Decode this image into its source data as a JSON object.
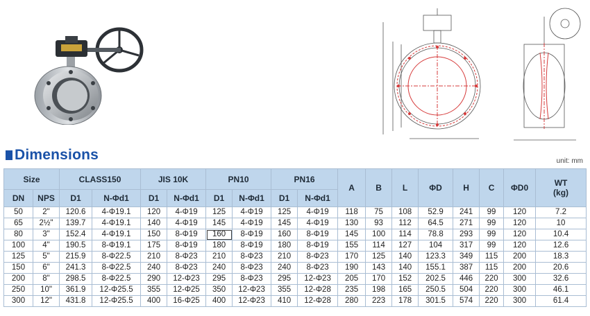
{
  "heading": "Dimensions",
  "unit_label": "unit: mm",
  "header_groups": [
    "Size",
    "CLASS150",
    "JIS 10K",
    "PN10",
    "PN16"
  ],
  "header_single": [
    "A",
    "B",
    "L",
    "ΦD",
    "H",
    "C",
    "ΦD0",
    "WT\n(kg)"
  ],
  "sub_headers": [
    "DN",
    "NPS",
    "D1",
    "N-Φd1",
    "D1",
    "N-Φd1",
    "D1",
    "N-Φd1",
    "D1",
    "N-Φd1"
  ],
  "rows": [
    [
      "50",
      "2\"",
      "120.6",
      "4-Φ19.1",
      "120",
      "4-Φ19",
      "125",
      "4-Φ19",
      "125",
      "4-Φ19",
      "118",
      "75",
      "108",
      "52.9",
      "241",
      "99",
      "120",
      "7.2"
    ],
    [
      "65",
      "2½\"",
      "139.7",
      "4-Φ19.1",
      "140",
      "4-Φ19",
      "145",
      "4-Φ19",
      "145",
      "4-Φ19",
      "130",
      "93",
      "112",
      "64.5",
      "271",
      "99",
      "120",
      "10"
    ],
    [
      "80",
      "3\"",
      "152.4",
      "4-Φ19.1",
      "150",
      "8-Φ19",
      "160",
      "8-Φ19",
      "160",
      "8-Φ19",
      "145",
      "100",
      "114",
      "78.8",
      "293",
      "99",
      "120",
      "10.4"
    ],
    [
      "100",
      "4\"",
      "190.5",
      "8-Φ19.1",
      "175",
      "8-Φ19",
      "180",
      "8-Φ19",
      "180",
      "8-Φ19",
      "155",
      "114",
      "127",
      "104",
      "317",
      "99",
      "120",
      "12.6"
    ],
    [
      "125",
      "5\"",
      "215.9",
      "8-Φ22.5",
      "210",
      "8-Φ23",
      "210",
      "8-Φ23",
      "210",
      "8-Φ23",
      "170",
      "125",
      "140",
      "123.3",
      "349",
      "115",
      "200",
      "18.3"
    ],
    [
      "150",
      "6\"",
      "241.3",
      "8-Φ22.5",
      "240",
      "8-Φ23",
      "240",
      "8-Φ23",
      "240",
      "8-Φ23",
      "190",
      "143",
      "140",
      "155.1",
      "387",
      "115",
      "200",
      "20.6"
    ],
    [
      "200",
      "8\"",
      "298.5",
      "8-Φ22.5",
      "290",
      "12-Φ23",
      "295",
      "8-Φ23",
      "295",
      "12-Φ23",
      "205",
      "170",
      "152",
      "202.5",
      "446",
      "220",
      "300",
      "32.6"
    ],
    [
      "250",
      "10\"",
      "361.9",
      "12-Φ25.5",
      "355",
      "12-Φ25",
      "350",
      "12-Φ23",
      "355",
      "12-Φ28",
      "235",
      "198",
      "165",
      "250.5",
      "504",
      "220",
      "300",
      "46.1"
    ],
    [
      "300",
      "12\"",
      "431.8",
      "12-Φ25.5",
      "400",
      "16-Φ25",
      "400",
      "12-Φ23",
      "410",
      "12-Φ28",
      "280",
      "223",
      "178",
      "301.5",
      "574",
      "220",
      "300",
      "61.4"
    ]
  ],
  "colors": {
    "accent": "#1a52a8",
    "header_bg": "#bfd6ec",
    "grid": "#a9bdd3",
    "drawing_red": "#d63a3a"
  }
}
